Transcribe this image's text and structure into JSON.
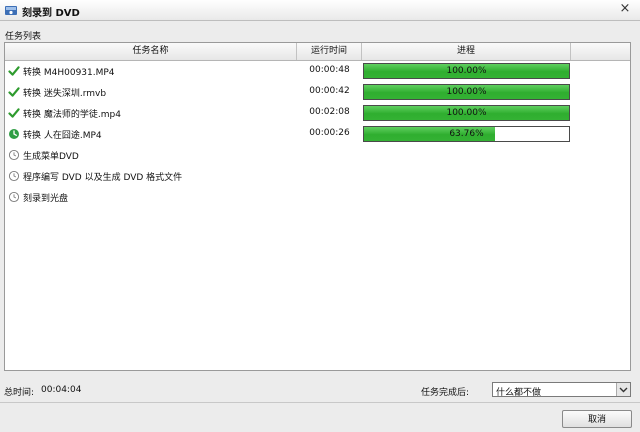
{
  "window": {
    "title": "刻录到 DVD",
    "close_glyph": "×",
    "app_icon": "dvd-burner-icon"
  },
  "section_label": "任务列表",
  "columns": {
    "name": "任务名称",
    "time": "运行时间",
    "progress": "进程"
  },
  "tasks": [
    {
      "name": "转换 M4H00931.MP4",
      "time": "00:00:48",
      "progress": 1.0,
      "progress_text": "100.00%",
      "status_icon": "checkmark-icon"
    },
    {
      "name": "转换 迷失深圳.rmvb",
      "time": "00:00:42",
      "progress": 1.0,
      "progress_text": "100.00%",
      "status_icon": "checkmark-icon"
    },
    {
      "name": "转换 魔法师的学徒.mp4",
      "time": "00:02:08",
      "progress": 1.0,
      "progress_text": "100.00%",
      "status_icon": "checkmark-icon"
    },
    {
      "name": "转换 人在囧途.MP4",
      "time": "00:00:26",
      "progress": 0.6376,
      "progress_text": "63.76%",
      "status_icon": "in-progress-icon"
    }
  ],
  "steps": [
    {
      "name": "生成菜单DVD",
      "status_icon": "pending-clock-icon"
    },
    {
      "name": "程序编写 DVD 以及生成 DVD 格式文件",
      "status_icon": "pending-clock-icon"
    },
    {
      "name": "刻录到光盘",
      "status_icon": "pending-clock-icon"
    }
  ],
  "footer": {
    "total_label": "总时间:",
    "total_value": "00:04:04",
    "after_label": "任务完成后:",
    "after_value": "什么都不做",
    "cancel_label": "取消"
  },
  "colors": {
    "progress_fill": "#34b234",
    "check": "#2e9b2e"
  }
}
